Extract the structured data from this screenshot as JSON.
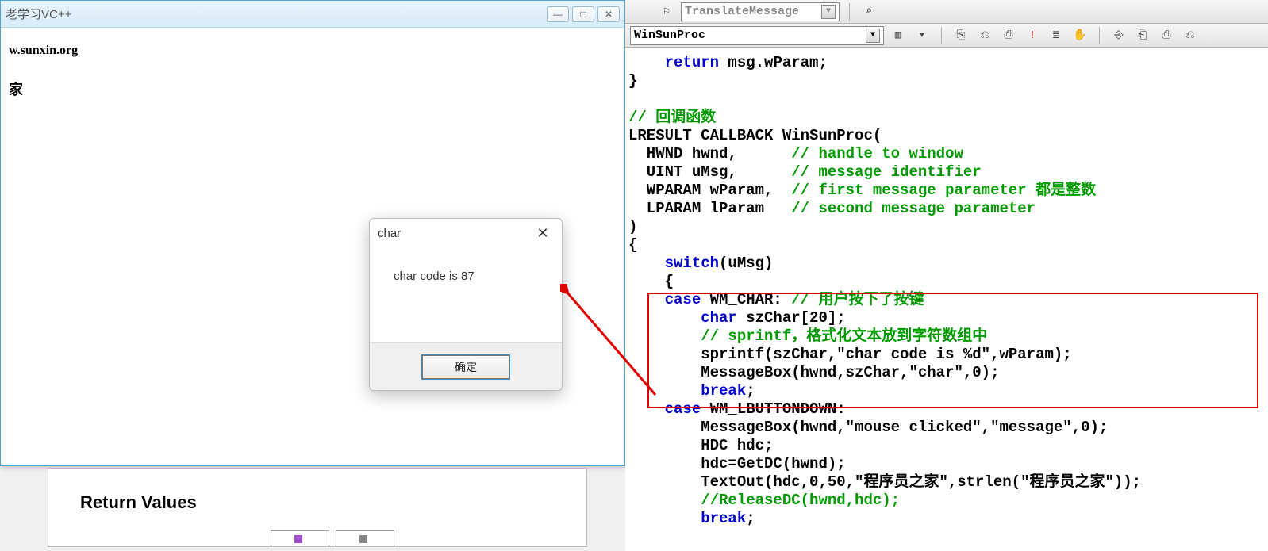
{
  "appWindow": {
    "title": "老学习VC++",
    "url": "w.sunxin.org",
    "text2": "家",
    "minGlyph": "—",
    "maxGlyph": "□",
    "closeGlyph": "✕"
  },
  "msgbox": {
    "title": "char",
    "body": "char code is 87",
    "ok": "确定",
    "closeGlyph": "✕"
  },
  "help": {
    "heading": "Return Values",
    "tab1": "",
    "tab2": ""
  },
  "toolbar1": {
    "combo": "TranslateMessage",
    "iconGlyphs": [
      "⌕",
      "⚑"
    ]
  },
  "toolbar2": {
    "combo": "WinSunProc",
    "group1": [
      "▥",
      "▾"
    ],
    "group2": [
      "⎘",
      "⎌",
      "⎙",
      "!",
      "≣",
      "✋"
    ],
    "group3": [
      "⎆",
      "⎗",
      "⎙",
      "⎌"
    ]
  },
  "code": {
    "l1a": "return",
    "l1b": " msg.wParam;",
    "l2": "}",
    "l3": "",
    "l4": "// 回调函数",
    "l5a": "LRESULT CALLBACK WinSunProc(",
    "l6a": "  HWND hwnd,      ",
    "l6b": "// handle to window",
    "l7a": "  UINT uMsg,      ",
    "l7b": "// message identifier",
    "l8a": "  WPARAM wParam,  ",
    "l8b": "// first message parameter 都是整数",
    "l9a": "  LPARAM lParam   ",
    "l9b": "// second message parameter",
    "l10": ")",
    "l11": "{",
    "l12a": "    ",
    "l12b": "switch",
    "l12c": "(uMsg)",
    "l13": "    {",
    "l14a": "    ",
    "l14b": "case",
    "l14c": " WM_CHAR: ",
    "l14d": "// 用户按下了按键",
    "l15a": "        ",
    "l15b": "char",
    "l15c": " szChar[20];",
    "l16a": "        ",
    "l16b": "// sprintf，格式化文本放到字符数组中",
    "l17": "        sprintf(szChar,\"char code is %d\",wParam);",
    "l18": "        MessageBox(hwnd,szChar,\"char\",0);",
    "l19a": "        ",
    "l19b": "break",
    "l19c": ";",
    "l20a": "    ",
    "l20b": "case",
    "l20c": " WM_LBUTTONDOWN:",
    "l21": "        MessageBox(hwnd,\"mouse clicked\",\"message\",0);",
    "l22": "        HDC hdc;",
    "l23": "        hdc=GetDC(hwnd);",
    "l24": "        TextOut(hdc,0,50,\"程序员之家\",strlen(\"程序员之家\"));",
    "l25": "        //ReleaseDC(hwnd,hdc);",
    "l26a": "        ",
    "l26b": "break",
    "l26c": ";"
  }
}
